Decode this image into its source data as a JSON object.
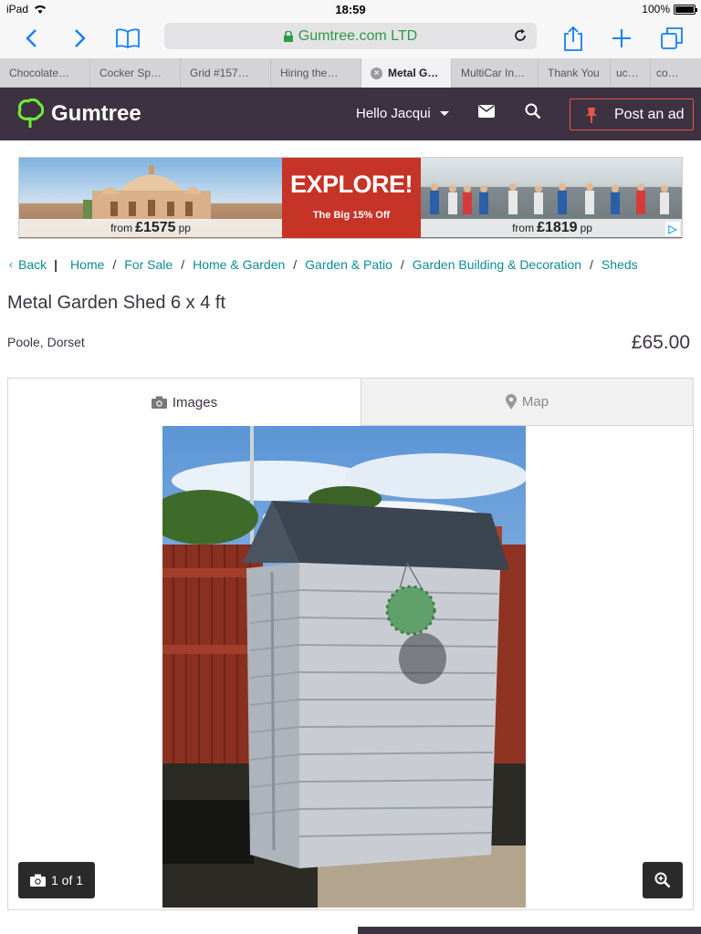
{
  "status_bar": {
    "device": "iPad",
    "time": "18:59",
    "battery": "100%"
  },
  "browser": {
    "address": "Gumtree.com LTD",
    "tabs": [
      {
        "label": "Chocolate…",
        "active": false
      },
      {
        "label": "Cocker Sp…",
        "active": false
      },
      {
        "label": "Grid #157…",
        "active": false
      },
      {
        "label": "Hiring the…",
        "active": false
      },
      {
        "label": "Metal G…",
        "active": true
      },
      {
        "label": "MultiCar In…",
        "active": false
      },
      {
        "label": "Thank You",
        "active": false
      },
      {
        "label": "uc…",
        "active": false
      },
      {
        "label": "co…",
        "active": false
      }
    ]
  },
  "header": {
    "logo": "Gumtree",
    "greeting": "Hello Jacqui",
    "post_ad": "Post an ad",
    "brand_color": "#3c3241",
    "accent_color": "#72ef36"
  },
  "ad": {
    "headline": "EXPLORE!",
    "sub": "The Big 15% Off",
    "left_prefix": "from",
    "left_price": "£1575",
    "left_suffix": "pp",
    "right_prefix": "from",
    "right_price": "£1819",
    "right_suffix": "pp",
    "choice_icon": "adchoices-icon"
  },
  "breadcrumb": {
    "back": "Back",
    "items": [
      "Home",
      "For Sale",
      "Home & Garden",
      "Garden & Patio",
      "Garden Building & Decoration",
      "Sheds"
    ]
  },
  "listing": {
    "title": "Metal Garden Shed 6 x 4 ft",
    "location": "Poole, Dorset",
    "price": "£65.00"
  },
  "gallery": {
    "tab_images": "Images",
    "tab_map": "Map",
    "counter": "1 of 1"
  }
}
